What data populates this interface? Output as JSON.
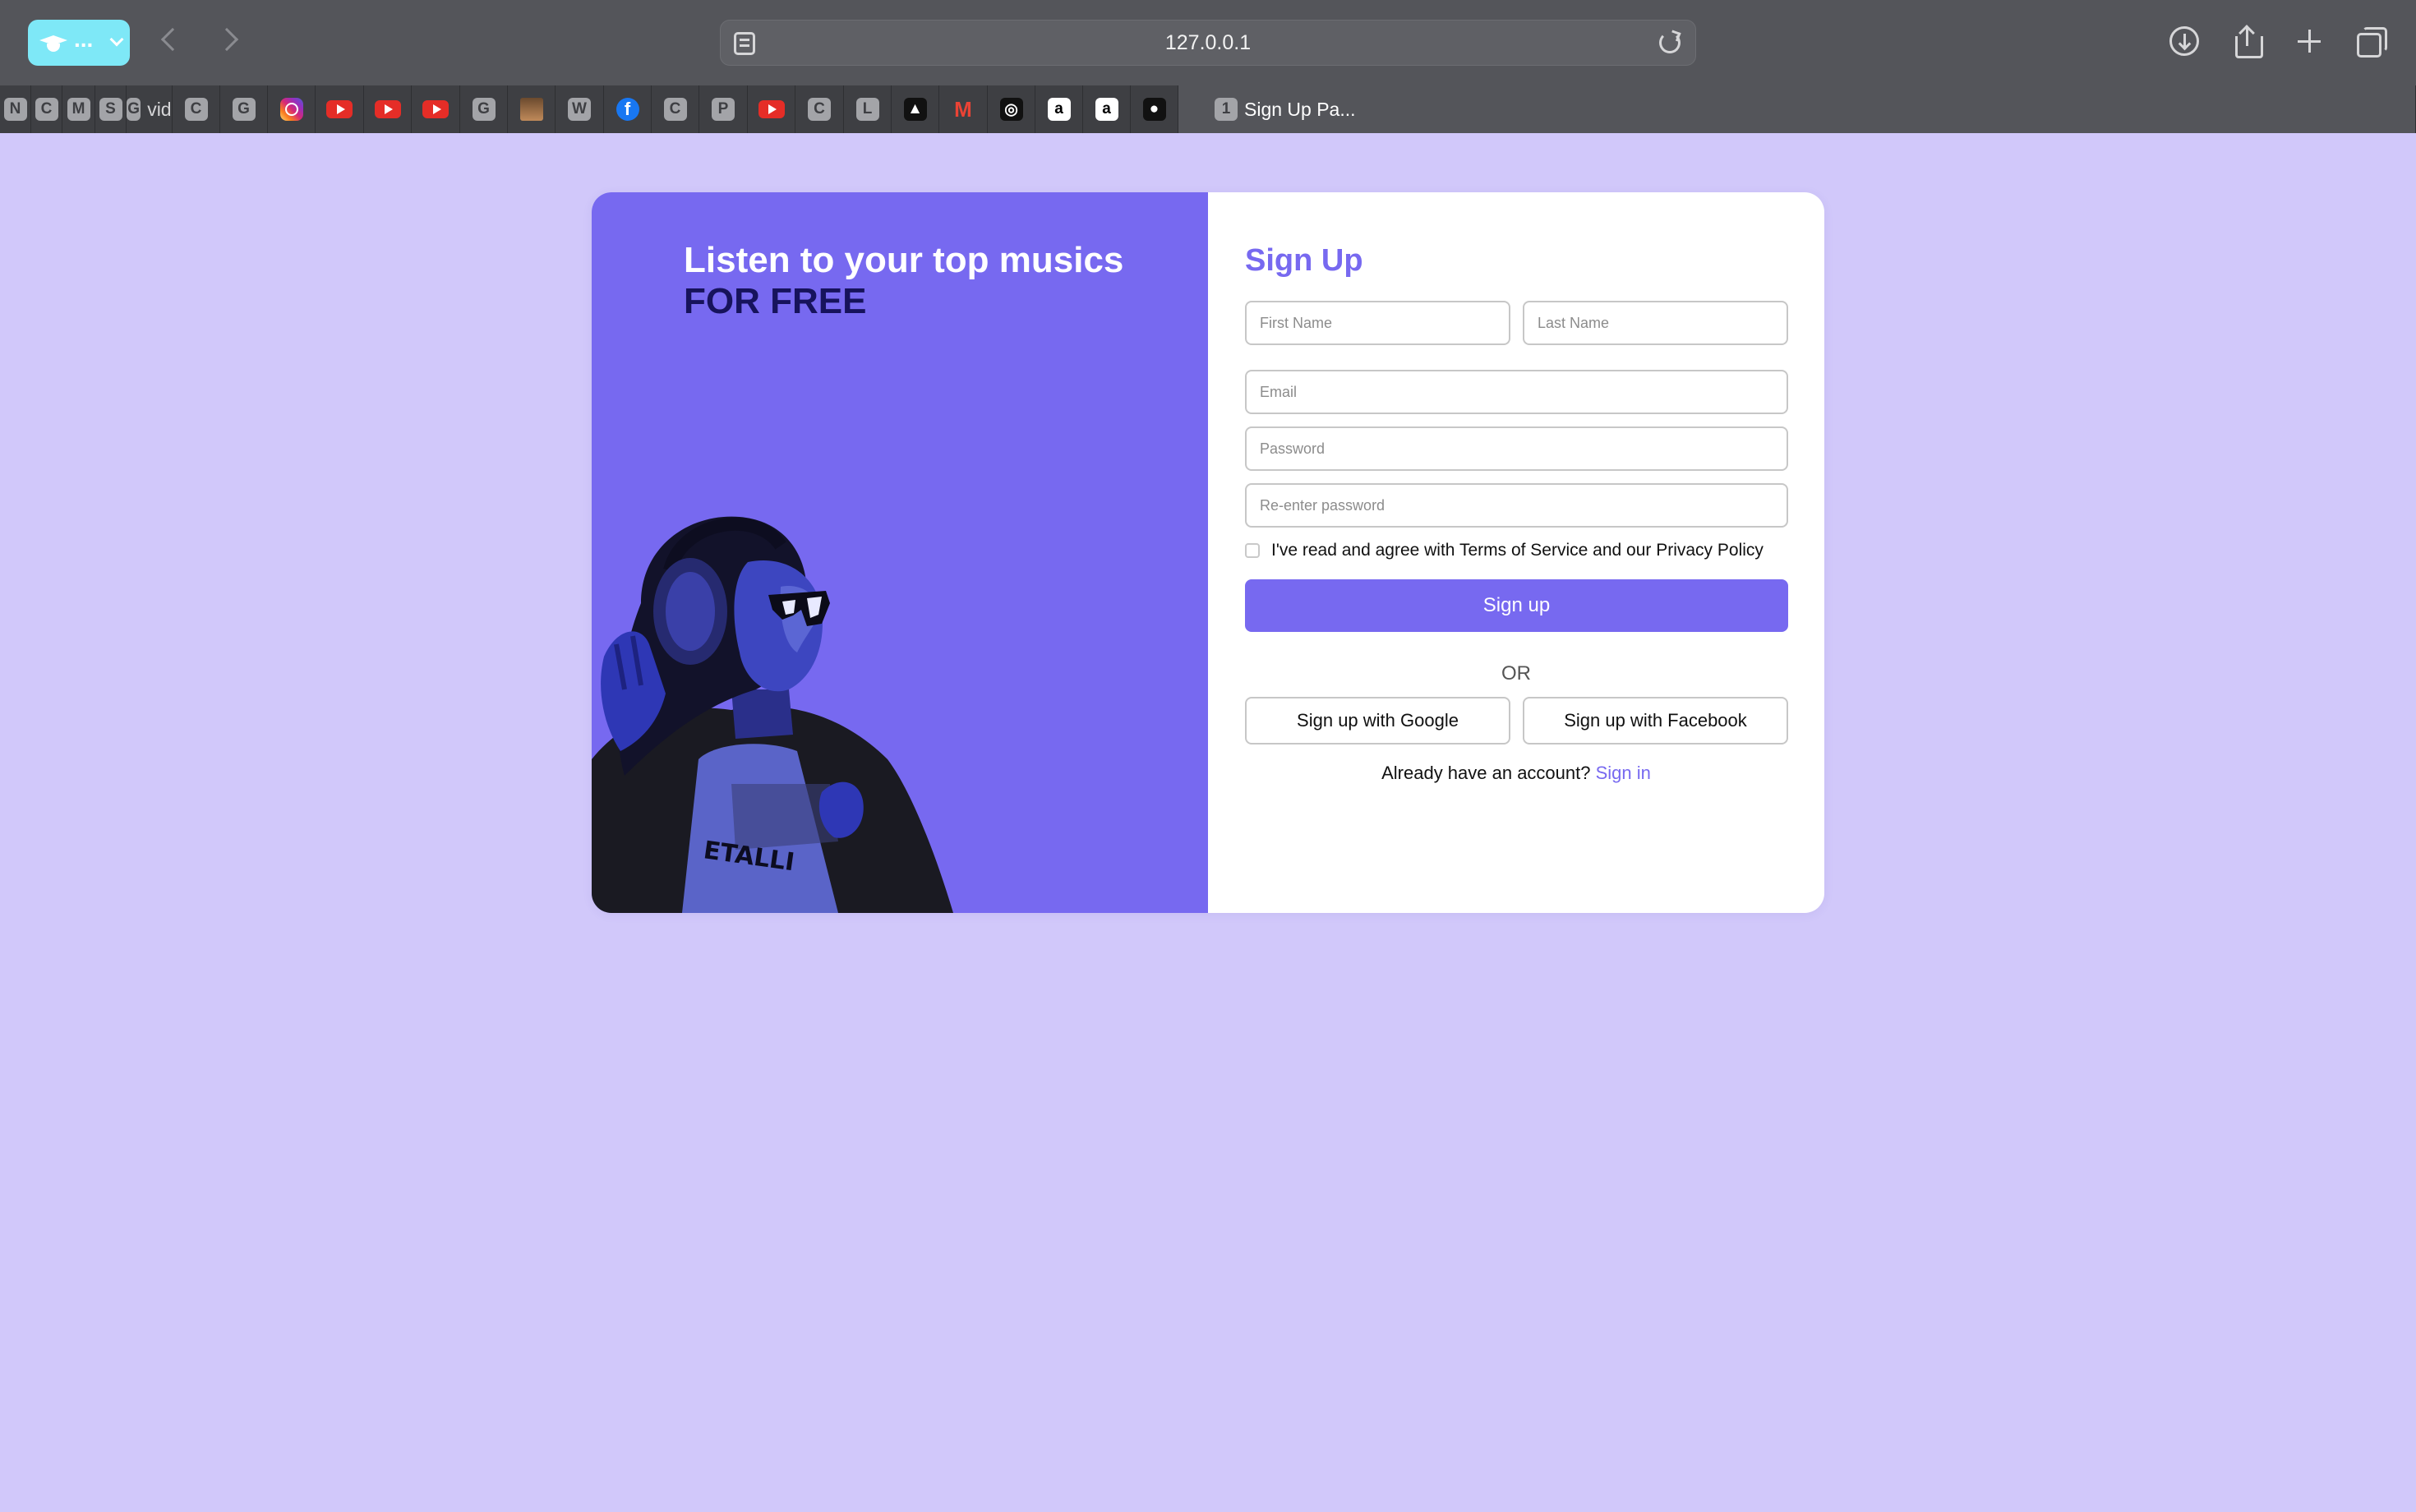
{
  "browser": {
    "url": "127.0.0.1",
    "profile_label": "...",
    "tabs": [
      {
        "icon": "letter",
        "letter": "N",
        "title": ""
      },
      {
        "icon": "letter",
        "letter": "C",
        "title": ""
      },
      {
        "icon": "letter",
        "letter": "M",
        "title": ""
      },
      {
        "icon": "letter",
        "letter": "S",
        "title": ""
      },
      {
        "icon": "letter",
        "letter": "G",
        "title": "vid..."
      },
      {
        "icon": "letter",
        "letter": "C",
        "title": ""
      },
      {
        "icon": "letter",
        "letter": "G",
        "title": ""
      },
      {
        "icon": "instagram-icon",
        "letter": "",
        "title": ""
      },
      {
        "icon": "youtube-icon",
        "letter": "",
        "title": ""
      },
      {
        "icon": "youtube-icon",
        "letter": "",
        "title": ""
      },
      {
        "icon": "youtube-icon",
        "letter": "",
        "title": ""
      },
      {
        "icon": "letter",
        "letter": "G",
        "title": ""
      },
      {
        "icon": "photo-icon",
        "letter": "",
        "title": ""
      },
      {
        "icon": "letter",
        "letter": "W",
        "title": ""
      },
      {
        "icon": "facebook-icon",
        "letter": "f",
        "title": ""
      },
      {
        "icon": "letter",
        "letter": "C",
        "title": ""
      },
      {
        "icon": "letter",
        "letter": "P",
        "title": ""
      },
      {
        "icon": "youtube-icon",
        "letter": "",
        "title": ""
      },
      {
        "icon": "letter",
        "letter": "C",
        "title": ""
      },
      {
        "icon": "letter",
        "letter": "L",
        "title": ""
      },
      {
        "icon": "triangle-logo-icon",
        "letter": "▲",
        "title": ""
      },
      {
        "icon": "gmail-icon",
        "letter": "M",
        "title": ""
      },
      {
        "icon": "openai-icon",
        "letter": "◎",
        "title": ""
      },
      {
        "icon": "amazon-icon",
        "letter": "a",
        "title": ""
      },
      {
        "icon": "amazon-icon",
        "letter": "a",
        "title": ""
      },
      {
        "icon": "github-icon",
        "letter": "●",
        "title": ""
      }
    ],
    "active_tab": {
      "letter": "1",
      "title": "Sign Up Pa..."
    }
  },
  "hero": {
    "title_line1": "Listen to your top musics",
    "title_line2": "FOR FREE"
  },
  "form": {
    "title": "Sign Up",
    "first_name_placeholder": "First Name",
    "last_name_placeholder": "Last Name",
    "email_placeholder": "Email",
    "password_placeholder": "Password",
    "reenter_password_placeholder": "Re-enter password",
    "terms_text": "I've read and agree with Terms of Service and our Privacy Policy",
    "signup_button": "Sign up",
    "or_text": "OR",
    "google_button": "Sign up with Google",
    "facebook_button": "Sign up with Facebook",
    "signin_prompt": "Already have an account?",
    "signin_link": "Sign in"
  },
  "colors": {
    "page_bg": "#d1c8fa",
    "accent": "#7769f0",
    "hero_dark_text": "#17135c"
  }
}
